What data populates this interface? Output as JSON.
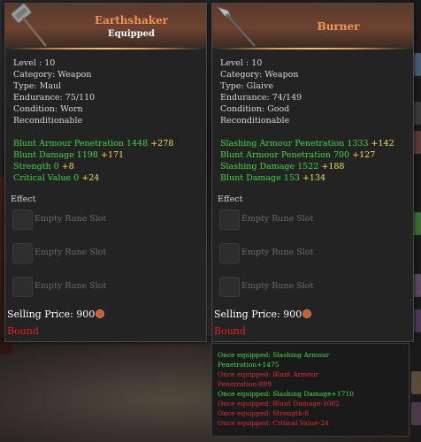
{
  "left_item": {
    "name": "Earthshaker",
    "equipped": "Equipped",
    "level": "Level : 10",
    "category": "Category: Weapon",
    "type": "Type: Maul",
    "endurance": "Endurance: 75/110",
    "condition": "Condition: Worn",
    "reconditionable": "Reconditionable",
    "stats": [
      {
        "name": "Blunt Armour Penetration 1448",
        "bonus": "+278"
      },
      {
        "name": "Blunt Damage 1198",
        "bonus": "+171"
      },
      {
        "name": "Strength 0",
        "bonus": "+8"
      },
      {
        "name": "Critical Value 0",
        "bonus": "+24"
      }
    ],
    "effect_label": "Effect",
    "rune_slots": [
      "Empty Rune Slot",
      "Empty Rune Slot",
      "Empty Rune Slot"
    ],
    "selling_price": "Selling Price: 900",
    "bound": "Bound",
    "icon": "maul-icon"
  },
  "right_item": {
    "name": "Burner",
    "level": "Level : 10",
    "category": "Category: Weapon",
    "type": "Type: Glaive",
    "endurance": "Endurance: 74/149",
    "condition": "Condition: Good",
    "reconditionable": "Reconditionable",
    "stats": [
      {
        "name": "Slashing Armour Penetration 1333",
        "bonus": "+142"
      },
      {
        "name": "Blunt Armour Penetration 700",
        "bonus": "+127"
      },
      {
        "name": "Slashing Damage 1522",
        "bonus": "+188"
      },
      {
        "name": "Blunt Damage 153",
        "bonus": "+134"
      }
    ],
    "effect_label": "Effect",
    "rune_slots": [
      "Empty Rune Slot",
      "Empty Rune Slot",
      "Empty Rune Slot"
    ],
    "selling_price": "Selling Price: 900",
    "bound": "Bound",
    "icon": "glaive-icon"
  },
  "comparison": [
    {
      "text": "Once equipped: Slashing Armour",
      "kind": "up"
    },
    {
      "text": "Penetration+1475",
      "kind": "up"
    },
    {
      "text": "Once equipped: Blunt Armour",
      "kind": "down"
    },
    {
      "text": "Penetration-899",
      "kind": "down"
    },
    {
      "text": "Once equipped: Slashing Damage+1710",
      "kind": "up"
    },
    {
      "text": "Once equipped: Blunt Damage-1082",
      "kind": "down"
    },
    {
      "text": "Once equipped: Strength-8",
      "kind": "down"
    },
    {
      "text": "Once equipped: Critical Value-24",
      "kind": "down"
    }
  ],
  "colors": {
    "item_name": "#f29552",
    "stat_green": "#3fd83f",
    "stat_bonus": "#f0e050",
    "bound_red": "#e02020"
  },
  "currency_icon": "coin-icon"
}
